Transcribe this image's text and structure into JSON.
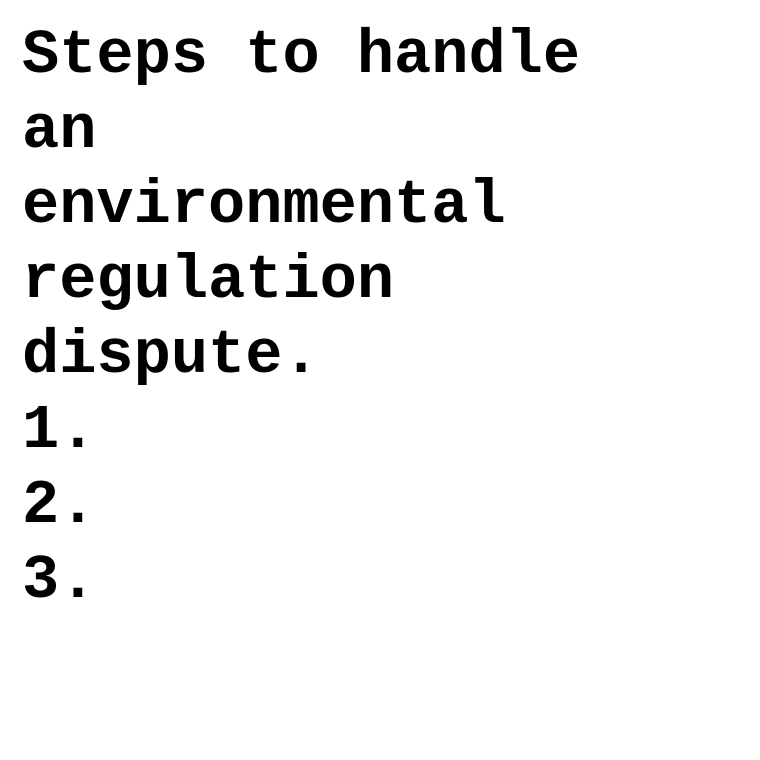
{
  "document": {
    "title_lines": [
      "Steps to handle",
      "an",
      "environmental",
      "regulation",
      "dispute."
    ],
    "list_items": [
      "1.",
      "2.",
      "3."
    ]
  }
}
